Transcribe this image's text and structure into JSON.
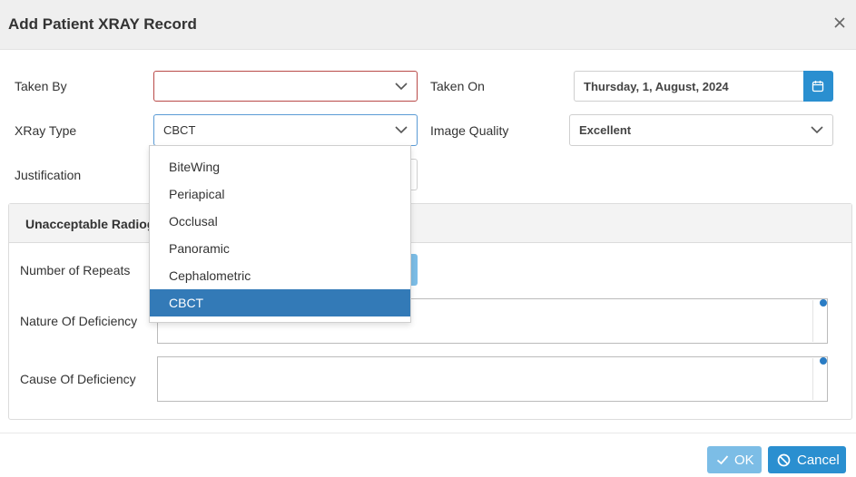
{
  "dialog": {
    "title": "Add Patient XRAY Record"
  },
  "form": {
    "taken_by": {
      "label": "Taken By",
      "value": ""
    },
    "taken_on": {
      "label": "Taken On",
      "value": "Thursday, 1, August, 2024"
    },
    "xray_type": {
      "label": "XRay Type",
      "value": "CBCT"
    },
    "image_quality": {
      "label": "Image Quality",
      "value": "Excellent"
    },
    "justification": {
      "label": "Justification"
    }
  },
  "panel": {
    "title": "Unacceptable Radiog",
    "number_of_repeats_label": "Number of Repeats",
    "nature_label": "Nature Of Deficiency",
    "cause_label": "Cause Of Deficiency"
  },
  "dropdown": {
    "options": [
      "BiteWing",
      "Periapical",
      "Occlusal",
      "Panoramic",
      "Cephalometric",
      "CBCT"
    ],
    "selected": "CBCT"
  },
  "footer": {
    "ok_label": "OK",
    "cancel_label": "Cancel"
  },
  "colors": {
    "primary": "#2a8fd0",
    "primary_disabled": "#7cbde6",
    "selected_option": "#337ab7",
    "invalid_border": "#b94a48"
  }
}
